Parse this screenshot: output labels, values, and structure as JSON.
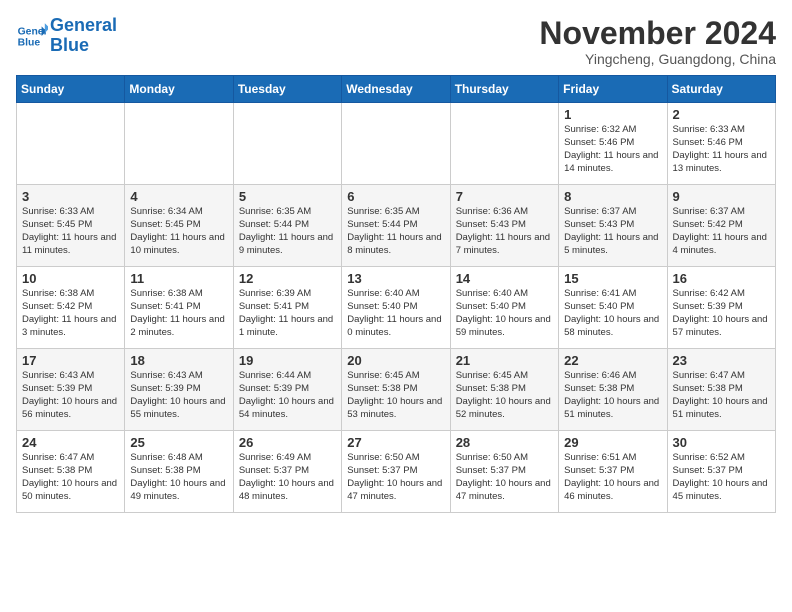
{
  "header": {
    "logo_line1": "General",
    "logo_line2": "Blue",
    "month_title": "November 2024",
    "location": "Yingcheng, Guangdong, China"
  },
  "weekdays": [
    "Sunday",
    "Monday",
    "Tuesday",
    "Wednesday",
    "Thursday",
    "Friday",
    "Saturday"
  ],
  "weeks": [
    [
      {
        "day": "",
        "info": ""
      },
      {
        "day": "",
        "info": ""
      },
      {
        "day": "",
        "info": ""
      },
      {
        "day": "",
        "info": ""
      },
      {
        "day": "",
        "info": ""
      },
      {
        "day": "1",
        "info": "Sunrise: 6:32 AM\nSunset: 5:46 PM\nDaylight: 11 hours and 14 minutes."
      },
      {
        "day": "2",
        "info": "Sunrise: 6:33 AM\nSunset: 5:46 PM\nDaylight: 11 hours and 13 minutes."
      }
    ],
    [
      {
        "day": "3",
        "info": "Sunrise: 6:33 AM\nSunset: 5:45 PM\nDaylight: 11 hours and 11 minutes."
      },
      {
        "day": "4",
        "info": "Sunrise: 6:34 AM\nSunset: 5:45 PM\nDaylight: 11 hours and 10 minutes."
      },
      {
        "day": "5",
        "info": "Sunrise: 6:35 AM\nSunset: 5:44 PM\nDaylight: 11 hours and 9 minutes."
      },
      {
        "day": "6",
        "info": "Sunrise: 6:35 AM\nSunset: 5:44 PM\nDaylight: 11 hours and 8 minutes."
      },
      {
        "day": "7",
        "info": "Sunrise: 6:36 AM\nSunset: 5:43 PM\nDaylight: 11 hours and 7 minutes."
      },
      {
        "day": "8",
        "info": "Sunrise: 6:37 AM\nSunset: 5:43 PM\nDaylight: 11 hours and 5 minutes."
      },
      {
        "day": "9",
        "info": "Sunrise: 6:37 AM\nSunset: 5:42 PM\nDaylight: 11 hours and 4 minutes."
      }
    ],
    [
      {
        "day": "10",
        "info": "Sunrise: 6:38 AM\nSunset: 5:42 PM\nDaylight: 11 hours and 3 minutes."
      },
      {
        "day": "11",
        "info": "Sunrise: 6:38 AM\nSunset: 5:41 PM\nDaylight: 11 hours and 2 minutes."
      },
      {
        "day": "12",
        "info": "Sunrise: 6:39 AM\nSunset: 5:41 PM\nDaylight: 11 hours and 1 minute."
      },
      {
        "day": "13",
        "info": "Sunrise: 6:40 AM\nSunset: 5:40 PM\nDaylight: 11 hours and 0 minutes."
      },
      {
        "day": "14",
        "info": "Sunrise: 6:40 AM\nSunset: 5:40 PM\nDaylight: 10 hours and 59 minutes."
      },
      {
        "day": "15",
        "info": "Sunrise: 6:41 AM\nSunset: 5:40 PM\nDaylight: 10 hours and 58 minutes."
      },
      {
        "day": "16",
        "info": "Sunrise: 6:42 AM\nSunset: 5:39 PM\nDaylight: 10 hours and 57 minutes."
      }
    ],
    [
      {
        "day": "17",
        "info": "Sunrise: 6:43 AM\nSunset: 5:39 PM\nDaylight: 10 hours and 56 minutes."
      },
      {
        "day": "18",
        "info": "Sunrise: 6:43 AM\nSunset: 5:39 PM\nDaylight: 10 hours and 55 minutes."
      },
      {
        "day": "19",
        "info": "Sunrise: 6:44 AM\nSunset: 5:39 PM\nDaylight: 10 hours and 54 minutes."
      },
      {
        "day": "20",
        "info": "Sunrise: 6:45 AM\nSunset: 5:38 PM\nDaylight: 10 hours and 53 minutes."
      },
      {
        "day": "21",
        "info": "Sunrise: 6:45 AM\nSunset: 5:38 PM\nDaylight: 10 hours and 52 minutes."
      },
      {
        "day": "22",
        "info": "Sunrise: 6:46 AM\nSunset: 5:38 PM\nDaylight: 10 hours and 51 minutes."
      },
      {
        "day": "23",
        "info": "Sunrise: 6:47 AM\nSunset: 5:38 PM\nDaylight: 10 hours and 51 minutes."
      }
    ],
    [
      {
        "day": "24",
        "info": "Sunrise: 6:47 AM\nSunset: 5:38 PM\nDaylight: 10 hours and 50 minutes."
      },
      {
        "day": "25",
        "info": "Sunrise: 6:48 AM\nSunset: 5:38 PM\nDaylight: 10 hours and 49 minutes."
      },
      {
        "day": "26",
        "info": "Sunrise: 6:49 AM\nSunset: 5:37 PM\nDaylight: 10 hours and 48 minutes."
      },
      {
        "day": "27",
        "info": "Sunrise: 6:50 AM\nSunset: 5:37 PM\nDaylight: 10 hours and 47 minutes."
      },
      {
        "day": "28",
        "info": "Sunrise: 6:50 AM\nSunset: 5:37 PM\nDaylight: 10 hours and 47 minutes."
      },
      {
        "day": "29",
        "info": "Sunrise: 6:51 AM\nSunset: 5:37 PM\nDaylight: 10 hours and 46 minutes."
      },
      {
        "day": "30",
        "info": "Sunrise: 6:52 AM\nSunset: 5:37 PM\nDaylight: 10 hours and 45 minutes."
      }
    ]
  ]
}
